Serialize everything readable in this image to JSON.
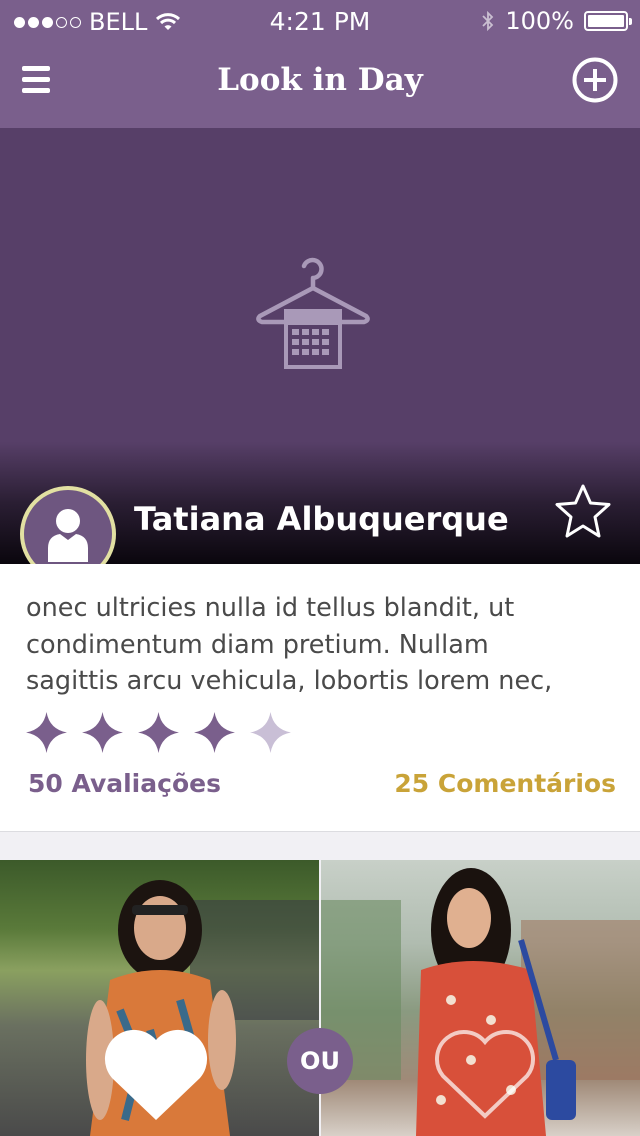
{
  "status_bar": {
    "carrier": "BELL",
    "time": "4:21 PM",
    "battery": "100%"
  },
  "header": {
    "title": "Look in Day"
  },
  "profile": {
    "name": "Tatiana Albuquerque"
  },
  "post": {
    "description_lines": [
      "onec ultricies nulla id tellus blandit, ut",
      "condimentum diam pretium. Nullam",
      "sagittis arcu vehicula, lobortis lorem nec,"
    ],
    "rating": {
      "value": 4,
      "max": 5
    },
    "reviews_label": "50 Avaliações",
    "comments_label": "25 Comentários"
  },
  "compare": {
    "or_label": "OU"
  },
  "colors": {
    "brand": "#7a5f8c",
    "hero": "#573f68",
    "accent_gold": "#c9a338",
    "avatar_ring": "#e2e0a2"
  },
  "icons": [
    "menu-icon",
    "add-icon",
    "hanger-calendar-icon",
    "avatar-icon",
    "star-outline-icon",
    "heart-icon"
  ]
}
